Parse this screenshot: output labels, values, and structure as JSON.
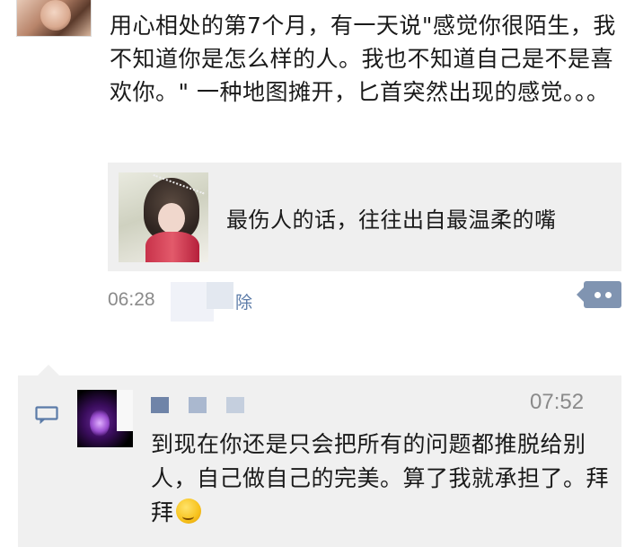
{
  "post": {
    "text": "用心相处的第7个月，有一天说\"感觉你很陌生，我不知道你是怎么样的人。我也不知道自己是不是喜欢你。\" 一种地图摊开，匕首突然出现的感觉。。。",
    "link_title": "最伤人的话，往往出自最温柔的嘴",
    "time": "06:28",
    "delete_label": "除"
  },
  "comment": {
    "time": "07:52",
    "text": "到现在你还是只会把所有的问题都推脱给别人，自己做自己的完美。算了我就承担了。拜拜",
    "emoji": "thinking-face-emoji"
  },
  "colors": {
    "link_blue": "#5b7ba8",
    "more_button": "#8094b1",
    "panel_bg": "#f0f0f0",
    "name_squares": [
      "#6f84a8",
      "#aab8cf",
      "#c5cfde"
    ]
  }
}
